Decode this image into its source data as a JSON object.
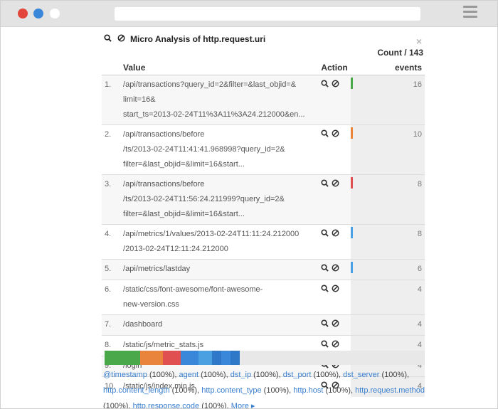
{
  "panel": {
    "title": "Micro Analysis of http.request.uri",
    "close": "×",
    "count_label": "Count / 143"
  },
  "table": {
    "headers": {
      "value": "Value",
      "action": "Action",
      "events": "events"
    },
    "rows": [
      {
        "idx": "1.",
        "lines": [
          "/api/transactions?query_id=2&filter=&last_objid=&",
          "limit=16&",
          "start_ts=2013-02-24T11%3A11%3A24.212000&en..."
        ],
        "events": "16",
        "color": "#4aa84a"
      },
      {
        "idx": "2.",
        "lines": [
          "/api/transactions/before",
          "/ts/2013-02-24T11:41:41.968998?query_id=2&",
          "filter=&last_objid=&limit=16&start..."
        ],
        "events": "10",
        "color": "#e8843c"
      },
      {
        "idx": "3.",
        "lines": [
          "/api/transactions/before",
          "/ts/2013-02-24T11:56:24.211999?query_id=2&",
          "filter=&last_objid=&limit=16&start..."
        ],
        "events": "8",
        "color": "#e05050"
      },
      {
        "idx": "4.",
        "lines": [
          "/api/metrics/1/values/2013-02-24T11:11:24.212000",
          "/2013-02-24T12:11:24.212000"
        ],
        "events": "8",
        "color": "#4aa0e0"
      },
      {
        "idx": "5.",
        "lines": [
          "/api/metrics/lastday"
        ],
        "events": "6",
        "color": "#4aa0e0"
      },
      {
        "idx": "6.",
        "lines": [
          "/static/css/font-awesome/font-awesome-",
          "new-version.css"
        ],
        "events": "4",
        "color": ""
      },
      {
        "idx": "7.",
        "lines": [
          "/dashboard"
        ],
        "events": "4",
        "color": ""
      },
      {
        "idx": "8.",
        "lines": [
          "/static/js/metric_stats.js"
        ],
        "events": "4",
        "color": ""
      },
      {
        "idx": "9.",
        "lines": [
          "/login"
        ],
        "events": "4",
        "color": ""
      },
      {
        "idx": "10.",
        "lines": [
          "/static/js/index.min.js"
        ],
        "events": "4",
        "color": ""
      }
    ]
  },
  "stackbar": [
    {
      "color": "#4aa84a",
      "fraction": 0.112
    },
    {
      "color": "#e8843c",
      "fraction": 0.07
    },
    {
      "color": "#e05050",
      "fraction": 0.056
    },
    {
      "color": "#3a86d8",
      "fraction": 0.056
    },
    {
      "color": "#4aa0e0",
      "fraction": 0.042
    },
    {
      "color": "#2f78c8",
      "fraction": 0.028
    },
    {
      "color": "#3a86d8",
      "fraction": 0.028
    },
    {
      "color": "#2f78c8",
      "fraction": 0.028
    }
  ],
  "fields": [
    {
      "name": "@timestamp",
      "pct": "(100%),"
    },
    {
      "name": "agent",
      "pct": "(100%),"
    },
    {
      "name": "dst_ip",
      "pct": "(100%),"
    },
    {
      "name": "dst_port",
      "pct": "(100%),"
    },
    {
      "name": "dst_server",
      "pct": "(100%),"
    },
    {
      "name": "http.content_length",
      "pct": "(100%),"
    },
    {
      "name": "http.content_type",
      "pct": "(100%),"
    },
    {
      "name": "http.host",
      "pct": "(100%),"
    },
    {
      "name": "http.request.method",
      "pct": "(100%),"
    },
    {
      "name": "http.response.code",
      "pct": "(100%),"
    }
  ],
  "more_label": "More ▸",
  "icons": {
    "search": "search-icon",
    "ban": "ban-icon"
  }
}
